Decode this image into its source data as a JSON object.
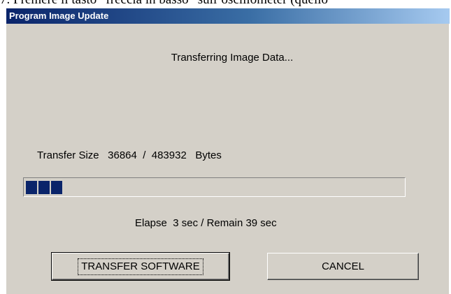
{
  "above_text": "7. Premere il tasto “freccia in basso” sull’oscillometer (quello",
  "dialog": {
    "title": "Program Image Update",
    "status": "Transferring Image Data...",
    "transfer_size": {
      "label": "Transfer Size",
      "current": "36864",
      "separator": " / ",
      "total": "483932",
      "unit": "Bytes"
    },
    "progress": {
      "value": 36864,
      "max": 483932,
      "blocks_shown": 3,
      "fill_color": "#0a246a"
    },
    "timing": {
      "elapse_label": "Elapse",
      "elapse_value": "3 sec",
      "separator": " / ",
      "remain_label": "Remain",
      "remain_value": "39 sec"
    },
    "buttons": {
      "transfer_label": "TRANSFER SOFTWARE",
      "cancel_label": "CANCEL"
    },
    "colors": {
      "face": "#d4d0c8",
      "title_start": "#0a246a",
      "title_end": "#a6caf0",
      "title_text": "#ffffff"
    }
  }
}
